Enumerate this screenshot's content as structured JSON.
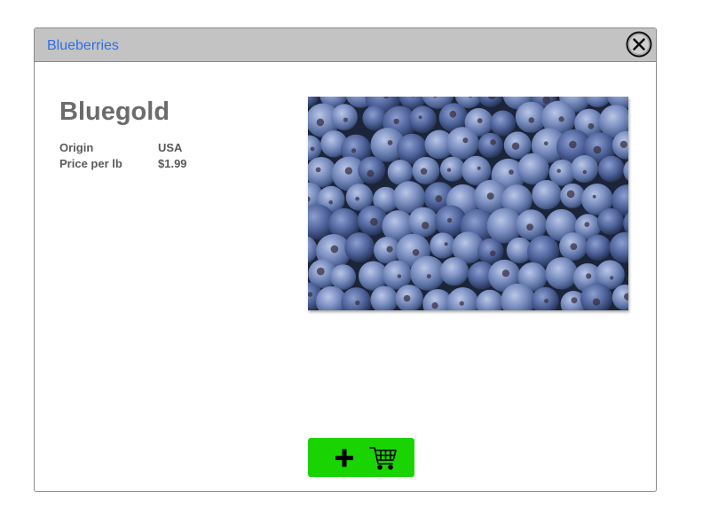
{
  "dialog": {
    "title": "Blueberries"
  },
  "product": {
    "name": "Bluegold",
    "details": [
      {
        "label": "Origin",
        "value": "USA"
      },
      {
        "label": "Price per lb",
        "value": "$1.99"
      }
    ],
    "image": {
      "subject": "blueberries-photo"
    }
  },
  "actions": {
    "close_icon": "close-icon",
    "add_to_cart_icons": [
      "plus-icon",
      "shopping-cart-icon"
    ]
  },
  "colors": {
    "titlebar": "#c3c3c3",
    "title_text": "#2f6fe8",
    "add_button": "#19d400",
    "heading": "#6b6b6b"
  }
}
